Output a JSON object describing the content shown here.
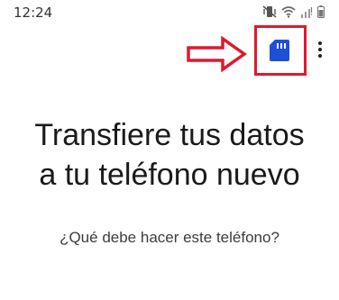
{
  "status_bar": {
    "time": "12:24",
    "icons": [
      "mute-vibrate-icon",
      "wifi-icon",
      "signal-icon",
      "battery-icon"
    ]
  },
  "toolbar": {
    "sd_card_icon": "sd-card-icon",
    "more_icon": "more-vert-icon",
    "accent_color": "#1f4fd6"
  },
  "annotation": {
    "arrow_color": "#e0182d",
    "highlight_color": "#e0182d"
  },
  "main": {
    "title_line1": "Transfiere tus datos",
    "title_line2": "a tu teléfono nuevo",
    "question": "¿Qué debe hacer este teléfono?"
  }
}
